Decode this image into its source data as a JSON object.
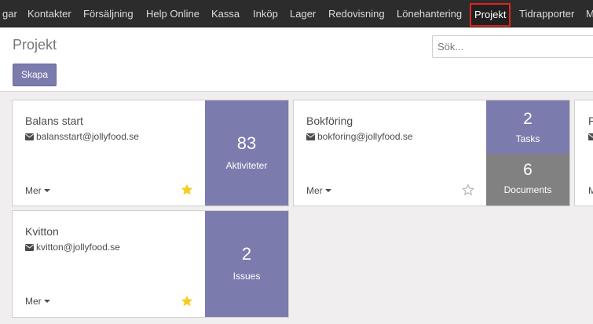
{
  "topbar": {
    "items": [
      "gar",
      "Kontakter",
      "Försäljning",
      "Help Online",
      "Kassa",
      "Inköp",
      "Lager",
      "Redovisning",
      "Lönehantering",
      "Projekt",
      "Tidrapporter",
      "M"
    ],
    "active": "Projekt"
  },
  "control_panel": {
    "title": "Projekt",
    "search_placeholder": "Sök...",
    "create_label": "Skapa"
  },
  "colors": {
    "accent": "#7c7bad",
    "gray_stat": "#818181",
    "star_on": "#f7cd1f",
    "star_off": "#b5b5b5",
    "active_outline": "#e0241c"
  },
  "projects": [
    {
      "name": "Balans start",
      "email": "balansstart@jollyfood.se",
      "more_label": "Mer",
      "favorite": true,
      "stats": [
        {
          "count": "83",
          "label": "Aktiviteter"
        }
      ]
    },
    {
      "name": "Bokföring",
      "email": "bokforing@jollyfood.se",
      "more_label": "Mer",
      "favorite": false,
      "stats": [
        {
          "count": "2",
          "label": "Tasks"
        },
        {
          "count": "6",
          "label": "Documents"
        }
      ]
    },
    {
      "name": "F",
      "email": "",
      "more_label": "M",
      "favorite": false,
      "stats": []
    },
    {
      "name": "Kvitton",
      "email": "kvitton@jollyfood.se",
      "more_label": "Mer",
      "favorite": true,
      "stats": [
        {
          "count": "2",
          "label": "Issues"
        }
      ]
    }
  ]
}
